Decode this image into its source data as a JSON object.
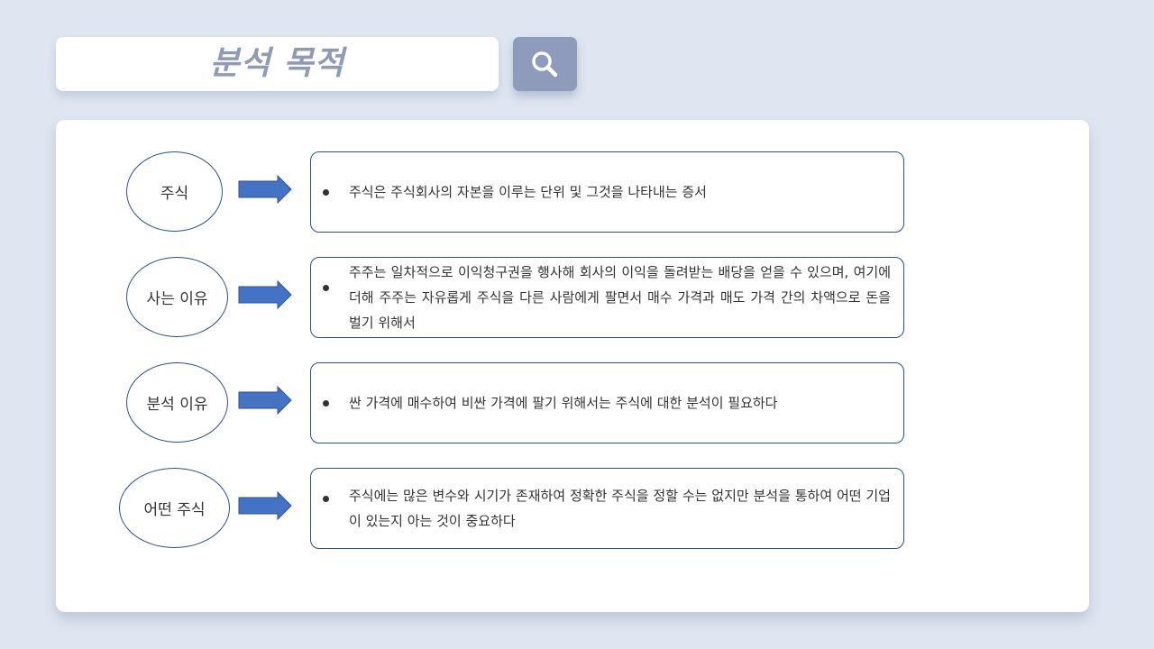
{
  "title": "분석 목적",
  "search_icon": "search-icon",
  "colors": {
    "background": "#dfe6f1",
    "title_text": "#8f9ab5",
    "search_button": "#8f9bbb",
    "arrow": "#4472c4",
    "outline": "#2f4f8a"
  },
  "rows": [
    {
      "term": "주식",
      "description": "주식은 주식회사의 자본을 이루는 단위 및 그것을 나타내는 증서"
    },
    {
      "term": "사는 이유",
      "description": "주주는 일차적으로 이익청구권을 행사해 회사의 이익을 돌려받는 배당을 얻을 수 있으며, 여기에 더해 주주는 자유롭게 주식을 다른 사람에게 팔면서 매수 가격과 매도 가격 간의 차액으로 돈을 벌기 위해서"
    },
    {
      "term": "분석 이유",
      "description": "싼 가격에 매수하여 비싼 가격에 팔기 위해서는 주식에 대한 분석이 필요하다"
    },
    {
      "term": "어떤 주식",
      "description": "주식에는 많은 변수와 시기가 존재하여 정확한 주식을 정할 수는 없지만 분석을 통하여 어떤 기업이 있는지 아는 것이 중요하다"
    }
  ]
}
